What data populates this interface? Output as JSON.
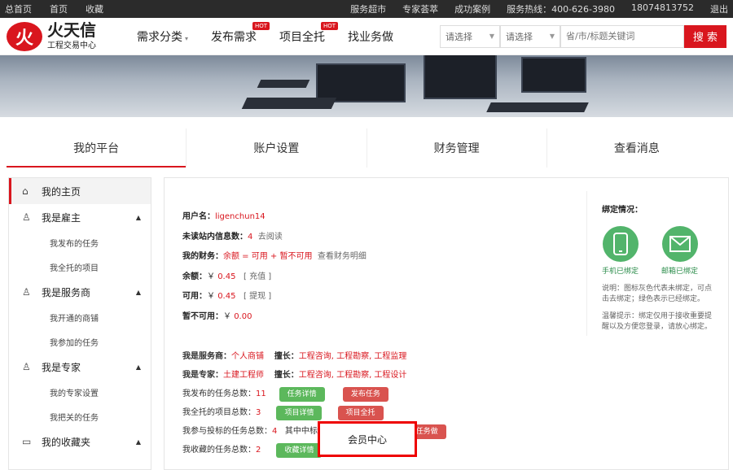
{
  "topbar": {
    "left": [
      "总首页",
      "首页",
      "收藏"
    ],
    "right": [
      "服务超市",
      "专家荟萃",
      "成功案例",
      "服务热线：400-626-3980",
      "18074813752",
      "退出"
    ]
  },
  "logo": {
    "mark": "火",
    "name": "火天信",
    "sub": "工程交易中心"
  },
  "nav": [
    {
      "label": "需求分类",
      "hot": "",
      "caret": "▾"
    },
    {
      "label": "发布需求",
      "hot": "HOT",
      "caret": ""
    },
    {
      "label": "项目全托",
      "hot": "HOT",
      "caret": ""
    },
    {
      "label": "找业务做",
      "hot": "",
      "caret": ""
    }
  ],
  "search": {
    "select1": "请选择",
    "select2": "请选择",
    "placeholder": "省/市/标题关键词",
    "button": "搜 索"
  },
  "tabs": [
    "我的平台",
    "账户设置",
    "财务管理",
    "查看消息"
  ],
  "sidebar": {
    "items": [
      {
        "label": "我的主页",
        "icon": "home-icon",
        "glyph": "⌂"
      },
      {
        "label": "我是雇主",
        "icon": "user-icon",
        "glyph": "♙"
      },
      {
        "label": "我发布的任务"
      },
      {
        "label": "我全托的项目"
      },
      {
        "label": "我是服务商",
        "icon": "person-icon",
        "glyph": "♙"
      },
      {
        "label": "我开通的商铺"
      },
      {
        "label": "我参加的任务"
      },
      {
        "label": "我是专家",
        "icon": "expert-icon",
        "glyph": "♙"
      },
      {
        "label": "我的专家设置"
      },
      {
        "label": "我把关的任务"
      },
      {
        "label": "我的收藏夹",
        "icon": "folder-icon",
        "glyph": "▭"
      }
    ]
  },
  "account": {
    "username_label": "用户名：",
    "username": "ligenchun14",
    "unread_label": "未读站内信息数：",
    "unread": "4",
    "unread_link": "去阅读",
    "finance_label": "我的财务：",
    "finance_formula": "余额 = 可用 + 暂不可用",
    "finance_link": "查看财务明细",
    "balance_label": "余额：",
    "balance_currency": "￥",
    "balance": "0.45",
    "recharge": "[ 充值 ]",
    "available_label": "可用：",
    "available_currency": "￥",
    "available": "0.45",
    "withdraw": "[ 提现 ]",
    "frozen_label": "暂不可用：",
    "frozen_currency": "￥",
    "frozen": "0.00"
  },
  "stats": {
    "provider_label": "我是服务商：",
    "provider_val": "个人商铺",
    "provider_skill_label": "擅长：",
    "provider_skill": "工程咨询, 工程勘察, 工程监理",
    "expert_label": "我是专家：",
    "expert_val": "土建工程师",
    "expert_skill_label": "擅长：",
    "expert_skill": "工程咨询, 工程勘察, 工程设计",
    "tasks_label": "我发布的任务总数：",
    "tasks": "11",
    "tasks_btn": "任务详情",
    "publish_btn": "发布任务",
    "projects_label": "我全托的项目总数：",
    "projects": "3",
    "projects_btn": "项目详情",
    "entrust_btn": "项目全托",
    "bids_label": "我参与投标的任务总数：",
    "bids": "4",
    "bids_extra": "其中中标",
    "find_btn": "找任务做",
    "fav_label": "我收藏的任务总数：",
    "fav": "2",
    "fav_btn": "收藏详情"
  },
  "binding": {
    "title": "绑定情况：",
    "phone": "手机已绑定",
    "email": "邮箱已绑定",
    "note": "说明：图标灰色代表未绑定，可点击去绑定；绿色表示已经绑定。",
    "tip": "温馨提示：绑定仅用于接收重要提醒以及方便您登录，请放心绑定。"
  },
  "popup": {
    "label": "会员中心"
  },
  "colors": {
    "accent": "#d9161e",
    "green": "#5cb85c",
    "bound": "#52b46b"
  }
}
